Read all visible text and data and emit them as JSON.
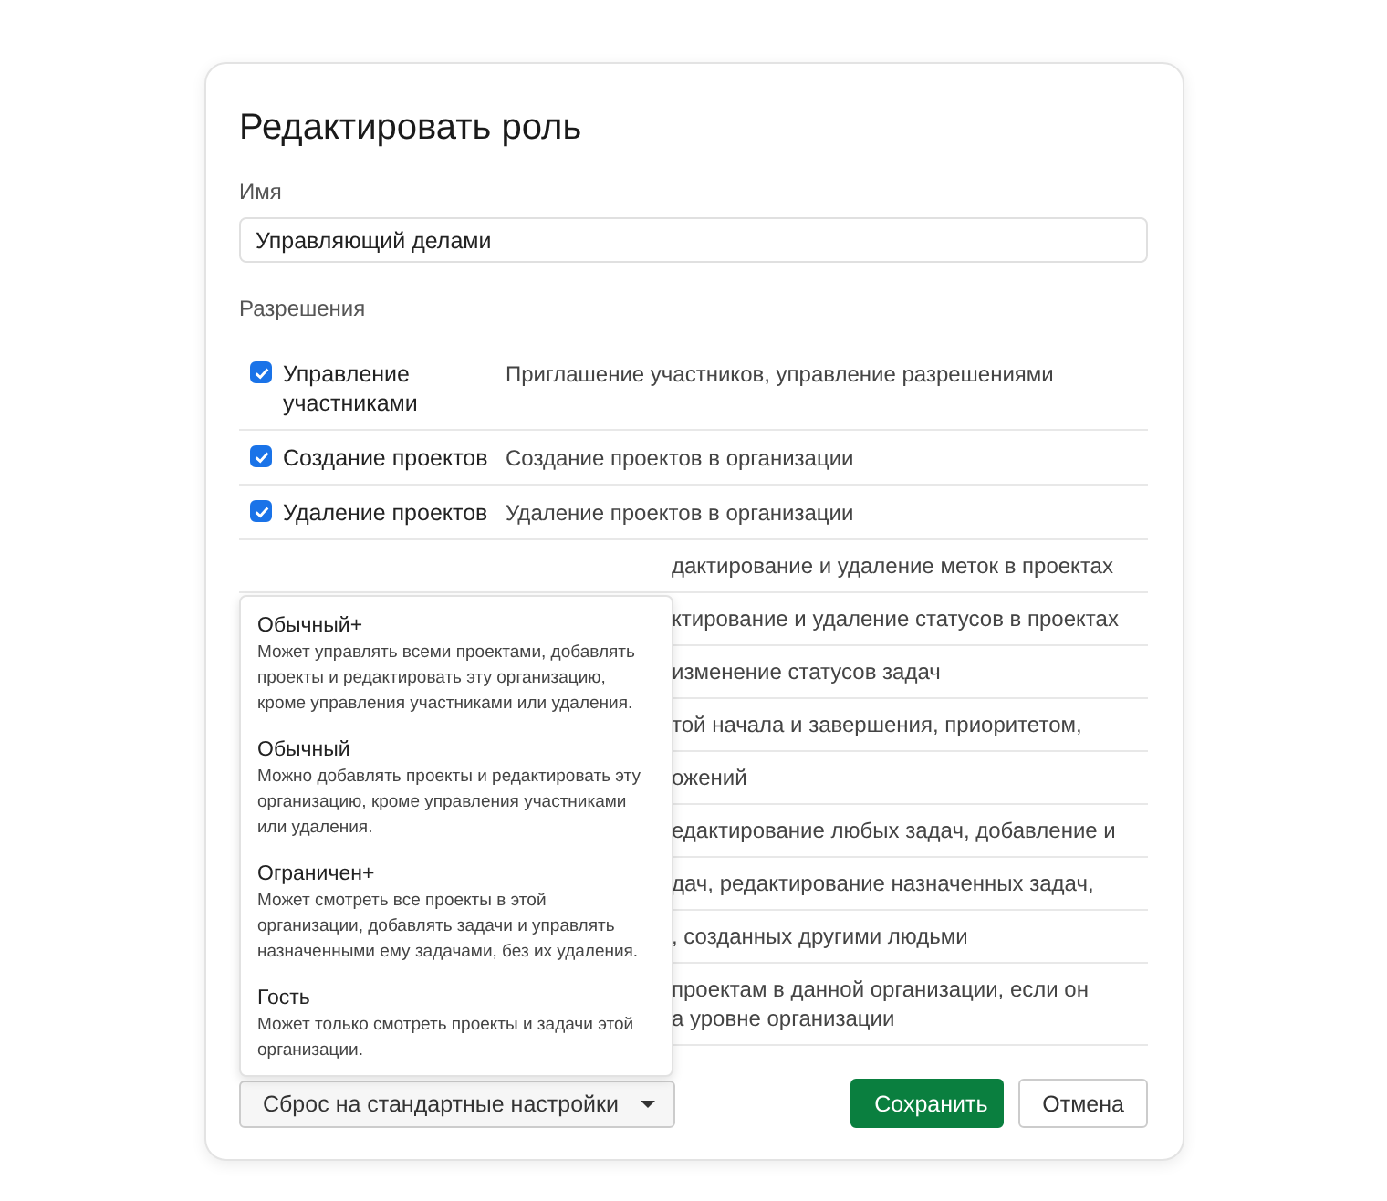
{
  "dialog": {
    "title": "Редактировать роль"
  },
  "name_field": {
    "label": "Имя",
    "value": "Управляющий делами"
  },
  "permissions": {
    "label": "Разрешения",
    "rows": [
      {
        "kind": "full",
        "name": "Управление участниками",
        "checked": true,
        "description": "Приглашение участников, управление разрешениями"
      },
      {
        "kind": "full",
        "name": "Создание проектов",
        "checked": true,
        "description": "Создание проектов в организации"
      },
      {
        "kind": "full",
        "name": "Удаление проектов",
        "checked": true,
        "description": "Удаление проектов в организации"
      },
      {
        "kind": "covered",
        "lines": [
          "дактирование и удаление меток в проектах"
        ]
      },
      {
        "kind": "covered",
        "lines": [
          "ктирование и удаление статусов в проектах"
        ]
      },
      {
        "kind": "covered",
        "lines": [
          "изменение статусов задач"
        ]
      },
      {
        "kind": "covered",
        "lines": [
          "той начала и завершения, приоритетом,"
        ]
      },
      {
        "kind": "covered",
        "lines": [
          "ожений"
        ]
      },
      {
        "kind": "covered",
        "lines": [
          "едактирование любых задач, добавление и"
        ]
      },
      {
        "kind": "covered",
        "lines": [
          "дач, редактирование назначенных задач,"
        ]
      },
      {
        "kind": "covered",
        "lines": [
          ", созданных другими людьми"
        ]
      },
      {
        "kind": "covered",
        "lines": [
          "проектам в данной организации, если он",
          "а уровне организации"
        ]
      }
    ]
  },
  "preset_menu": {
    "items": [
      {
        "title": "Обычный+",
        "description": "Может управлять всеми проектами, добавлять проекты и редактировать эту организацию, кроме управления участниками или удаления."
      },
      {
        "title": "Обычный",
        "description": "Можно добавлять проекты и редактировать эту организацию, кроме управления участниками или удаления."
      },
      {
        "title": "Ограничен+",
        "description": "Может смотреть все проекты в этой организации, добавлять задачи и управлять назначенными ему задачами, без их удаления."
      },
      {
        "title": "Гость",
        "description": "Может только смотреть проекты и задачи этой организации."
      }
    ]
  },
  "reset_dropdown": {
    "label": "Сброс на стандартные настройки"
  },
  "buttons": [
    {
      "kind": "primary",
      "label": "Сохранить"
    },
    {
      "kind": "secondary",
      "label": "Отмена"
    }
  ]
}
